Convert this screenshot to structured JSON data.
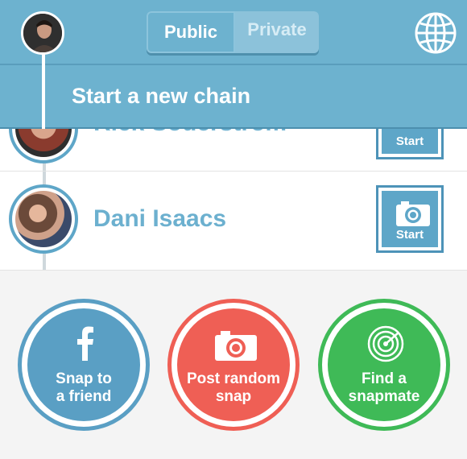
{
  "header": {
    "tabs": [
      {
        "label": "Public",
        "active": true
      },
      {
        "label": "Private",
        "active": false
      }
    ],
    "new_chain_label": "Start a new chain",
    "globe_icon": "globe-icon"
  },
  "chains": [
    {
      "name": "Rick Soderstrom",
      "action_label": "Start",
      "partially_hidden": true
    },
    {
      "name": "Dani Isaacs",
      "action_label": "Start"
    }
  ],
  "actions": [
    {
      "label_line1": "Snap to",
      "label_line2": "a friend",
      "icon": "facebook-icon",
      "color": "#5a9fc4"
    },
    {
      "label_line1": "Post random",
      "label_line2": "snap",
      "icon": "camera-icon",
      "color": "#ef5f55"
    },
    {
      "label_line1": "Find a",
      "label_line2": "snapmate",
      "icon": "radar-icon",
      "color": "#3fba57"
    }
  ],
  "colors": {
    "header": "#6db2cf",
    "accent": "#5ea6c8",
    "name_text": "#6cb0cf"
  }
}
